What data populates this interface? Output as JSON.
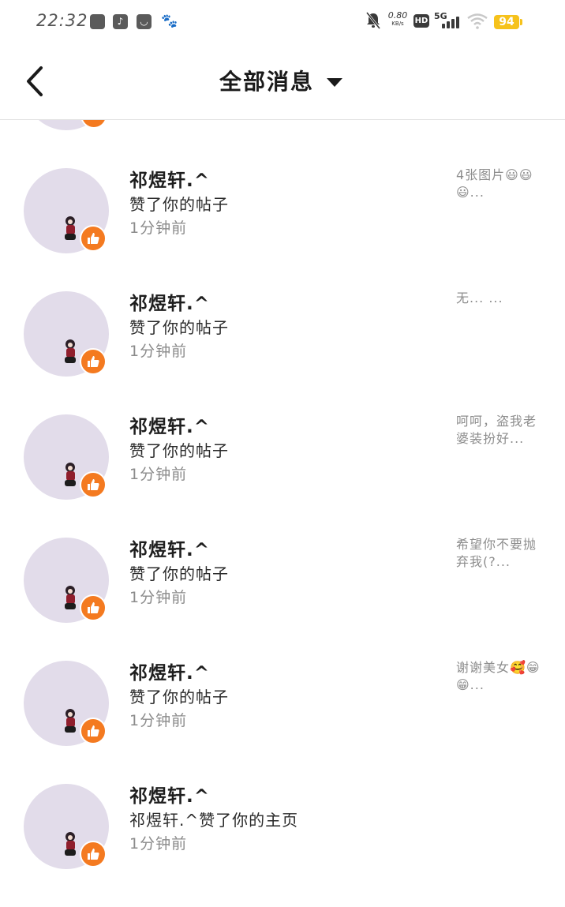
{
  "status_bar": {
    "time": "22:32",
    "net_speed_value": "0.80",
    "net_speed_unit": "KB/s",
    "hd_label": "HD",
    "network_label": "5G",
    "battery": "94",
    "app_icons": [
      "gallery-app-icon",
      "tiktok-app-icon",
      "taobao-app-icon",
      "baidu-app-icon"
    ]
  },
  "nav": {
    "title": "全部消息",
    "back_icon": "chevron-left-icon",
    "dropdown_icon": "caret-down-icon"
  },
  "colors": {
    "like_badge": "#f47a20",
    "avatar_bg": "#e2dcea",
    "battery": "#f6c21b"
  },
  "messages": [
    {
      "user": "祁煜轩.^",
      "action": "赞了你的帖子",
      "time": "1分钟前",
      "preview": "4张图片😃😃😃..."
    },
    {
      "user": "祁煜轩.^",
      "action": "赞了你的帖子",
      "time": "1分钟前",
      "preview": "无...  ..."
    },
    {
      "user": "祁煜轩.^",
      "action": "赞了你的帖子",
      "time": "1分钟前",
      "preview": "呵呵，盗我老婆装扮好..."
    },
    {
      "user": "祁煜轩.^",
      "action": "赞了你的帖子",
      "time": "1分钟前",
      "preview": "希望你不要抛弃我(?..."
    },
    {
      "user": "祁煜轩.^",
      "action": "赞了你的帖子",
      "time": "1分钟前",
      "preview": "谢谢美女🥰😁😁..."
    },
    {
      "user": "祁煜轩.^",
      "action": "祁煜轩.^赞了你的主页",
      "time": "1分钟前",
      "preview": ""
    }
  ]
}
